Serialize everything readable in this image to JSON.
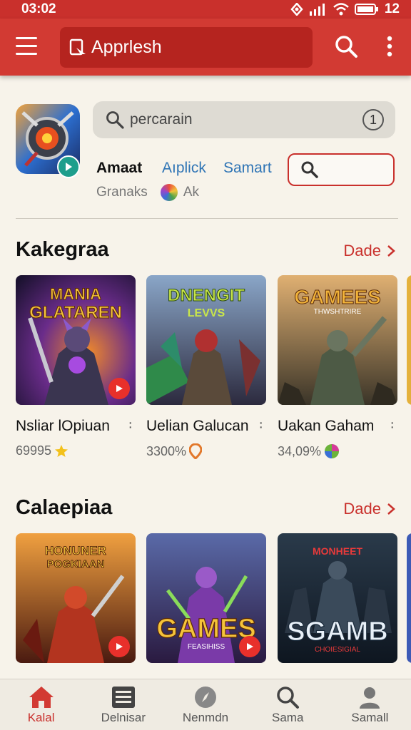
{
  "status_bar": {
    "time": "03:02",
    "battery": "12"
  },
  "app_bar": {
    "search_text": "Apprlesh"
  },
  "header": {
    "search_placeholder": "percarain",
    "search_counter": "1",
    "tabs": [
      {
        "label": "Amaat"
      },
      {
        "label": "Aıplick"
      },
      {
        "label": "Samart"
      }
    ],
    "meta_left": "Granaks",
    "meta_right": "Ak"
  },
  "sections": [
    {
      "title": "Kakegraa",
      "more_label": "Dade",
      "cards": [
        {
          "art_text_1": "MANIA",
          "art_text_2": "GLATAREN",
          "title": "Nsliar lOpiuan",
          "rating": "69995",
          "rating_icon": "star-icon",
          "rating_color": "#f3c11b"
        },
        {
          "art_text_1": "DNENGIT",
          "art_text_2": "LEVVS",
          "title": "Uelian Galucan",
          "rating": "3300%",
          "rating_icon": "location-pin-icon",
          "rating_color": "#e2782b"
        },
        {
          "art_text_1": "GAMEES",
          "art_text_2": "THWSHTRIRE",
          "title": "Uakan Gaham",
          "rating": "34,09%",
          "rating_icon": "game-ball-icon",
          "rating_color": "#6bb33b"
        }
      ]
    },
    {
      "title": "Calaepiaa",
      "more_label": "Dade",
      "cards": [
        {
          "art_text_1": "HONUNER",
          "art_text_2": "POGKIAAN"
        },
        {
          "art_text_1": "GAMES",
          "art_text_2": "FEASIHISS"
        },
        {
          "art_text_1": "MONHEET",
          "art_text_2": "SGAMB",
          "art_text_3": "CHOIESIGIAL"
        }
      ]
    }
  ],
  "bottom_nav": [
    {
      "label": "Kalal",
      "icon": "home-icon",
      "active": true
    },
    {
      "label": "Delnisar",
      "icon": "list-icon",
      "active": false
    },
    {
      "label": "Nenmdn",
      "icon": "compass-icon",
      "active": false
    },
    {
      "label": "Sama",
      "icon": "search-icon",
      "active": false
    },
    {
      "label": "Samall",
      "icon": "person-icon",
      "active": false
    }
  ],
  "colors": {
    "brand": "#d23a33",
    "accent_link": "#2e74b5",
    "background": "#f7f3ea"
  }
}
